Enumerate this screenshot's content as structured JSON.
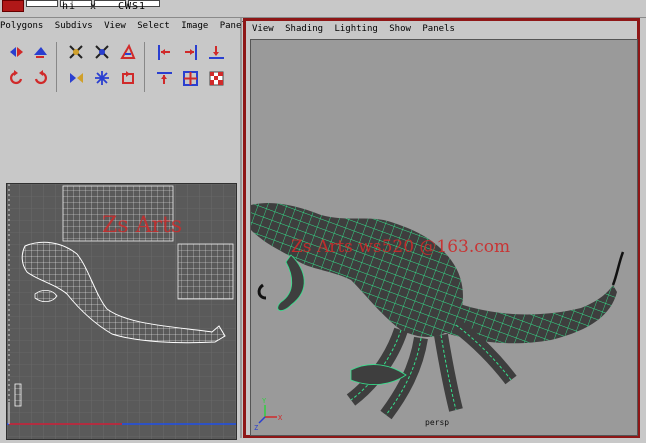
{
  "topbar": {
    "seg1": "hi",
    "seg2": "x",
    "seg3": "CWS1"
  },
  "left_menu": [
    "Polygons",
    "Subdivs",
    "View",
    "Select",
    "Image",
    "Panels"
  ],
  "right_menu": [
    "View",
    "Shading",
    "Lighting",
    "Show",
    "Panels"
  ],
  "viewport": {
    "camera_label": "persp",
    "watermark": "Zs Arts",
    "email_watermark": "Zs Arts  ws520  @163.com"
  },
  "axes": {
    "x": "X",
    "y": "Y",
    "z": "Z"
  },
  "colors": {
    "wire": "#35e08c",
    "frame": "#8e1717",
    "watermark": "#cc2b2b"
  }
}
